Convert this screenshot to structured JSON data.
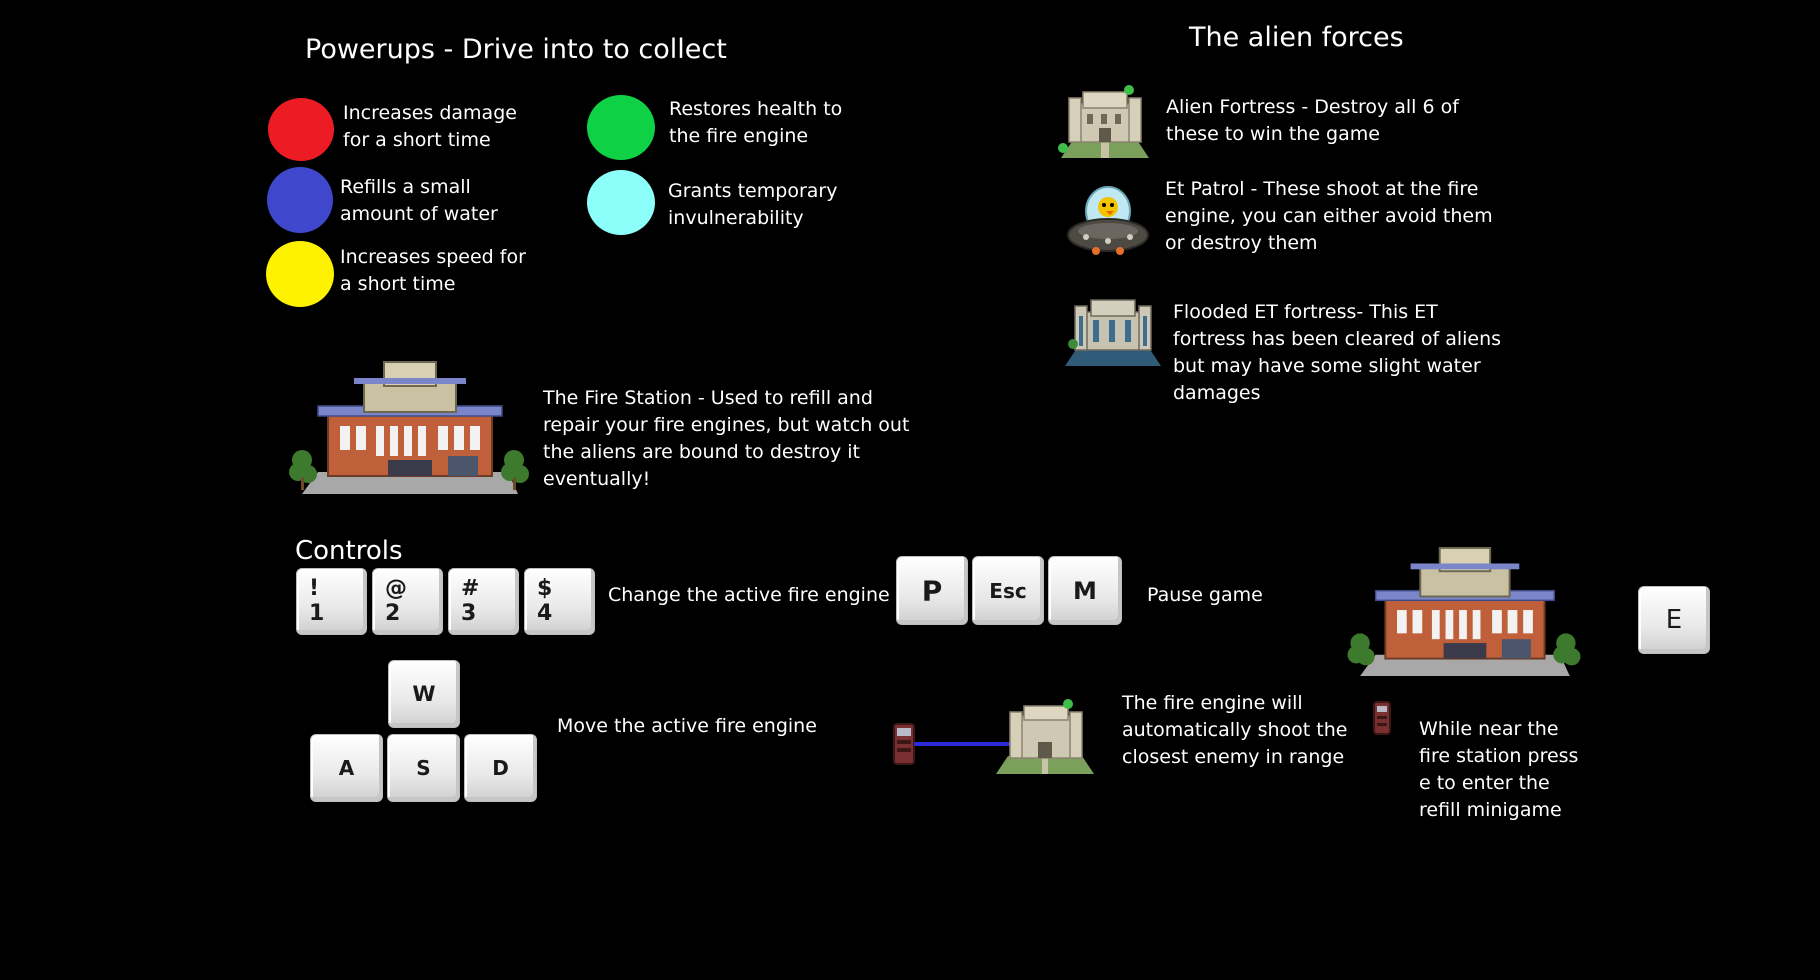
{
  "powerups": {
    "heading": "Powerups - Drive into to collect",
    "items": [
      {
        "color": "#ed1c24",
        "text": "Increases damage for a short time"
      },
      {
        "color": "#3f48cc",
        "text": "Refills a small amount of water"
      },
      {
        "color": "#fff200",
        "text": "Increases speed for a short time"
      },
      {
        "color": "#0ed145",
        "text": "Restores health to the fire engine"
      },
      {
        "color": "#8cfffb",
        "text": "Grants temporary invulnerability"
      }
    ]
  },
  "aliens": {
    "heading": "The alien forces",
    "items": [
      {
        "text": "Alien Fortress - Destroy all 6 of these to win the game"
      },
      {
        "text": "Et Patrol - These shoot at the fire engine, you can either avoid them or destroy them"
      },
      {
        "text": "Flooded ET fortress- This ET fortress has been cleared of aliens but may have some slight water damages"
      }
    ]
  },
  "fire_station": {
    "text": "The Fire Station - Used to refill and repair your fire engines, but watch out the aliens are bound to destroy it eventually!"
  },
  "controls": {
    "heading": "Controls",
    "number_keys": [
      {
        "top": "!",
        "bottom": "1"
      },
      {
        "top": "@",
        "bottom": "2"
      },
      {
        "top": "#",
        "bottom": "3"
      },
      {
        "top": "$",
        "bottom": "4"
      }
    ],
    "number_keys_text": "Change the active fire engine",
    "pause_keys": [
      "P",
      "Esc",
      "M"
    ],
    "pause_text": "Pause game",
    "move_keys": {
      "up": "W",
      "left": "A",
      "down": "S",
      "right": "D"
    },
    "move_text": "Move the active fire engine",
    "shoot_text": "The fire engine will automatically shoot the closest enemy in range",
    "refill_key": "E",
    "refill_text": "While near the fire station press e to enter the refill minigame"
  },
  "colors": {
    "background": "#000000",
    "text": "#ffffff",
    "water_beam": "#2a2ad8",
    "grass": "#7ba05b",
    "stone": "#cfc9b4",
    "brick": "#c0603a",
    "roof": "#7a86c9"
  }
}
